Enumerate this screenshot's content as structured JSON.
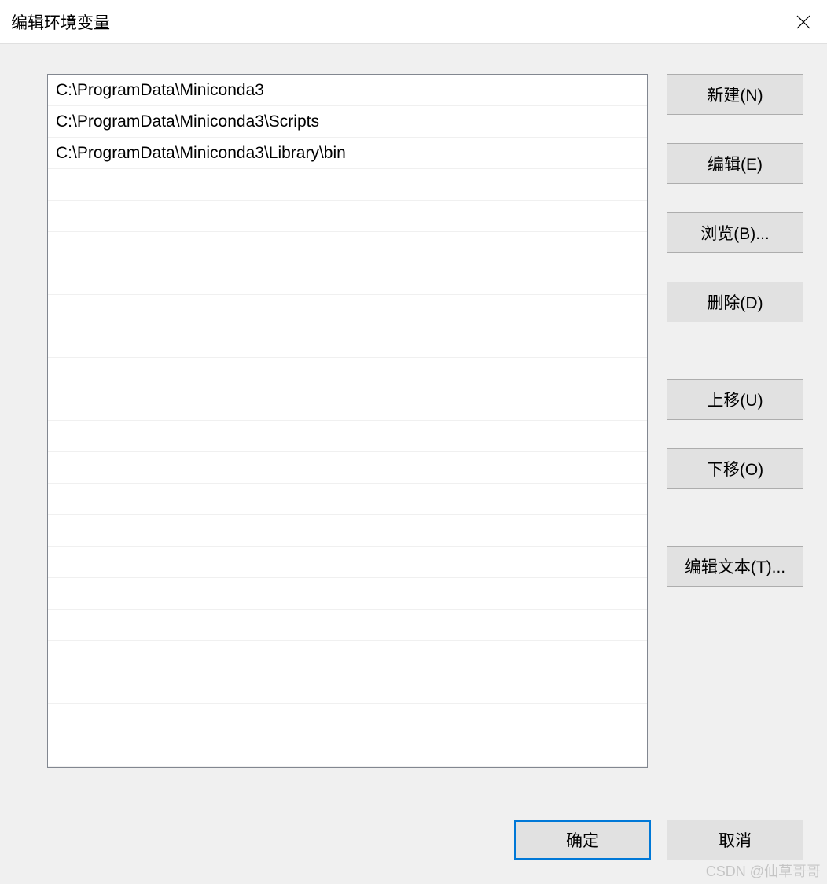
{
  "window": {
    "title": "编辑环境变量"
  },
  "paths": [
    "C:\\ProgramData\\Miniconda3",
    "C:\\ProgramData\\Miniconda3\\Scripts",
    "C:\\ProgramData\\Miniconda3\\Library\\bin"
  ],
  "buttons": {
    "new": "新建(N)",
    "edit": "编辑(E)",
    "browse": "浏览(B)...",
    "delete": "删除(D)",
    "move_up": "上移(U)",
    "move_down": "下移(O)",
    "edit_text": "编辑文本(T)...",
    "ok": "确定",
    "cancel": "取消"
  },
  "watermark": "CSDN @仙草哥哥"
}
